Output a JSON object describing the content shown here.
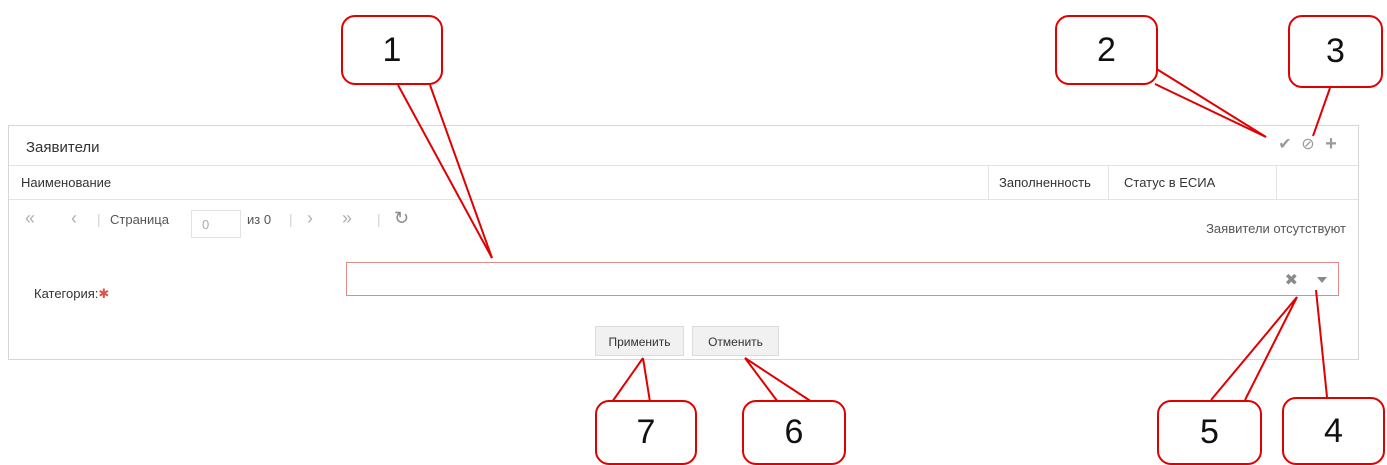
{
  "panel": {
    "title": "Заявители",
    "header_icons": [
      {
        "name": "check-icon",
        "glyph": "✔"
      },
      {
        "name": "ban-icon",
        "glyph": "⊘"
      },
      {
        "name": "plus-icon",
        "glyph": "+"
      }
    ]
  },
  "grid": {
    "columns": [
      "Наименование",
      "Заполненность",
      "Статус в ЕСИА",
      ""
    ]
  },
  "pager": {
    "first": "«",
    "prev": "‹",
    "page_label": "Страница",
    "page_value": "0",
    "of_label": "из 0",
    "next": "›",
    "last": "»",
    "refresh": "↻",
    "empty_message": "Заявители отсутствуют"
  },
  "form": {
    "category_label": "Категория:",
    "required_mark": "✱",
    "category_value": "",
    "clear": "✖"
  },
  "buttons": {
    "apply": "Применить",
    "cancel": "Отменить"
  },
  "callouts": [
    "1",
    "2",
    "3",
    "4",
    "5",
    "6",
    "7"
  ],
  "colors": {
    "callout_border": "#e00000",
    "required": "#d9534f",
    "invalid_border": "#e08a8a"
  }
}
